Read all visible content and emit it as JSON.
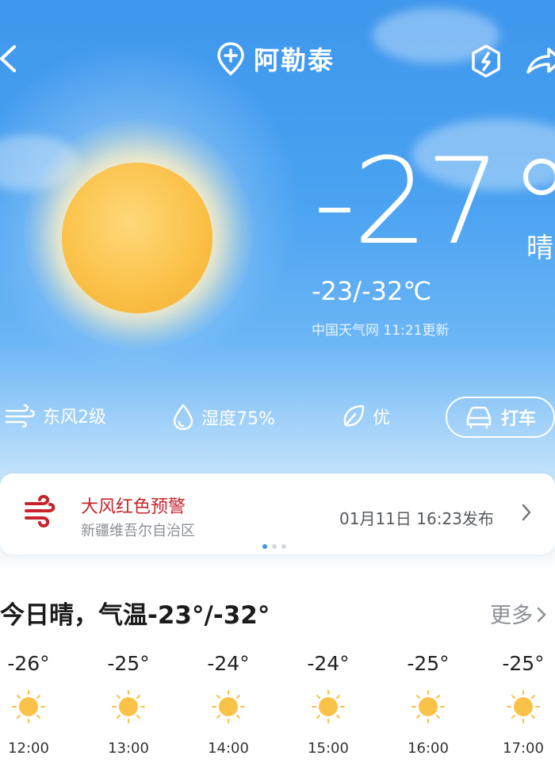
{
  "header": {
    "location": "阿勒泰",
    "icons": [
      "back-chevron-icon",
      "location-plus-icon",
      "bolt-hexagon-icon",
      "share-icon"
    ]
  },
  "current": {
    "temperature": "-27",
    "condition": "晴",
    "range": "-23/-32℃",
    "source": "中国天气网 11:21更新"
  },
  "stats": {
    "wind": "东风2级",
    "humidity": "湿度75%",
    "air_quality": "优",
    "taxi_label": "打车"
  },
  "alert": {
    "title": "大风红色预警",
    "region": "新疆维吾尔自治区",
    "time": "01月11日 16:23发布",
    "color": "#c6242a"
  },
  "today": {
    "summary": "今日晴，气温-23°/-32°",
    "more_label": "更多"
  },
  "hourly": [
    {
      "temp": "-26°",
      "time": "12:00",
      "icon": "sun-icon"
    },
    {
      "temp": "-25°",
      "time": "13:00",
      "icon": "sun-icon"
    },
    {
      "temp": "-24°",
      "time": "14:00",
      "icon": "sun-icon"
    },
    {
      "temp": "-24°",
      "time": "15:00",
      "icon": "sun-icon"
    },
    {
      "temp": "-25°",
      "time": "16:00",
      "icon": "sun-icon"
    },
    {
      "temp": "-25°",
      "time": "17:00",
      "icon": "sun-icon"
    }
  ],
  "colors": {
    "sky": "#3f97ee",
    "sun": "#fbc24a",
    "alert_red": "#c6242a",
    "indicator_active": "#3f97ee"
  }
}
